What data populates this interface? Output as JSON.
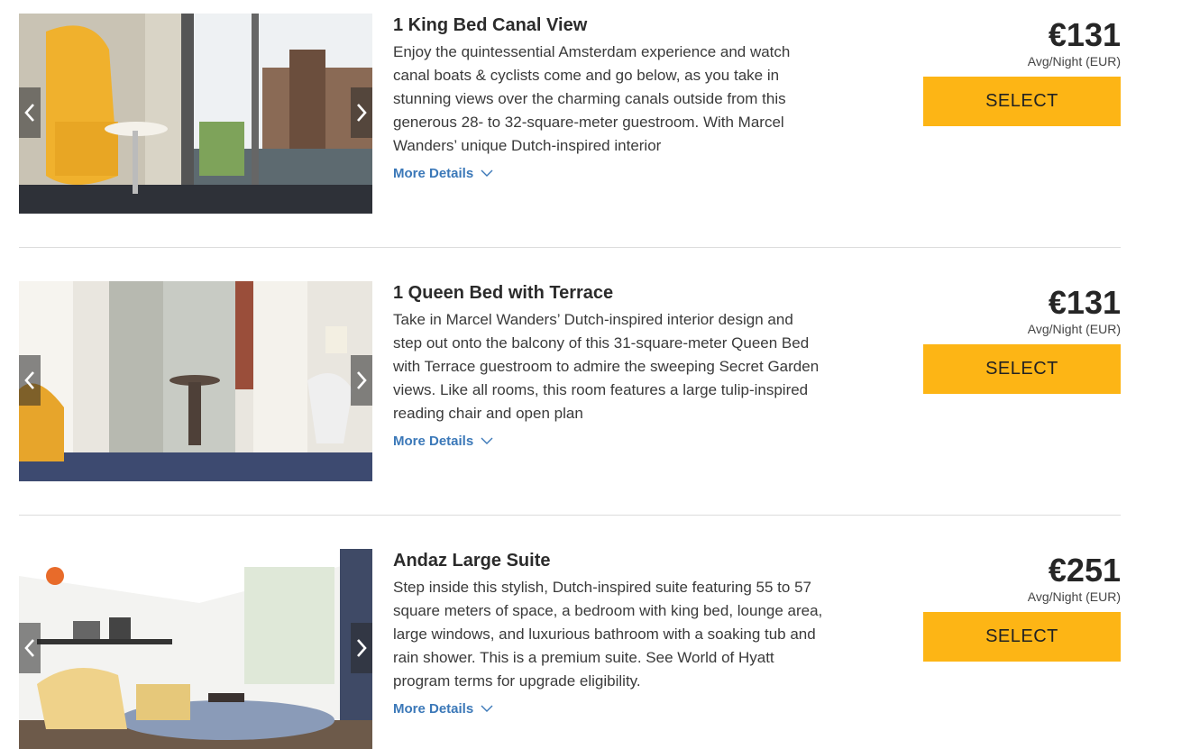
{
  "rooms": [
    {
      "title": "1 King Bed Canal View",
      "description": "Enjoy the quintessential Amsterdam experience and watch canal boats & cyclists come and go below, as you take in stunning views over the charming canals outside from this generous 28- to 32-square-meter guestroom. With Marcel Wanders’ unique Dutch-inspired interior",
      "more_details": "More Details",
      "price": "€131",
      "price_note": "Avg/Night (EUR)",
      "select_label": "SELECT"
    },
    {
      "title": "1 Queen Bed with Terrace",
      "description": "Take in Marcel Wanders’ Dutch-inspired interior design and step out onto the balcony of this 31-square-meter Queen Bed with Terrace guestroom to admire the sweeping Secret Garden views. Like all rooms, this room features a large tulip-inspired reading chair and open plan",
      "more_details": "More Details",
      "price": "€131",
      "price_note": "Avg/Night (EUR)",
      "select_label": "SELECT"
    },
    {
      "title": "Andaz Large Suite",
      "description": "Step inside this stylish, Dutch-inspired suite featuring 55 to 57 square meters of space, a bedroom with king bed, lounge area, large windows, and luxurious bathroom with a soaking tub and rain shower. This is a premium suite. See World of Hyatt program terms for upgrade eligibility.",
      "more_details": "More Details",
      "price": "€251",
      "price_note": "Avg/Night (EUR)",
      "select_label": "SELECT"
    }
  ],
  "icons": {
    "prev": "chevron-left-icon",
    "next": "chevron-right-icon",
    "expand": "chevron-down-icon"
  },
  "colors": {
    "select_button": "#fdb515",
    "link": "#3b78b8",
    "divider": "#dcdcdc"
  }
}
